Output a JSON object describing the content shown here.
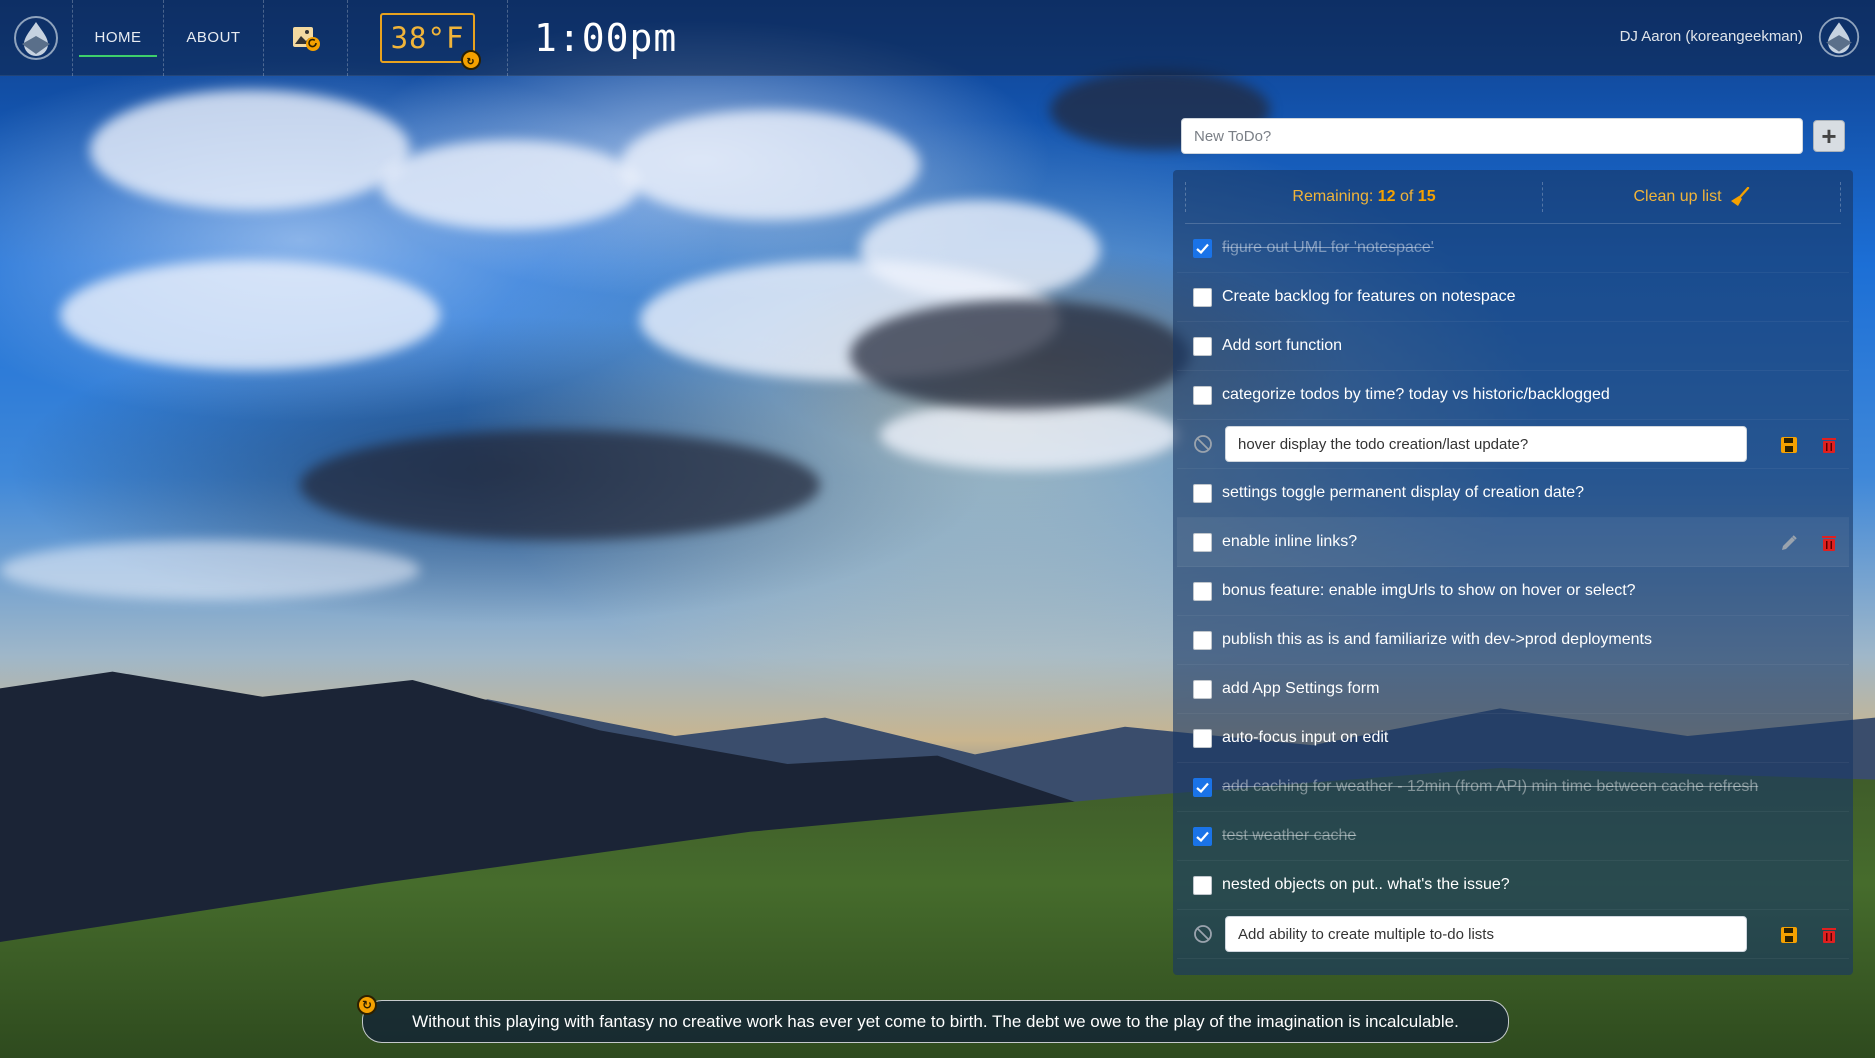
{
  "nav": {
    "home_label": "HOME",
    "about_label": "ABOUT",
    "weather_temp": "38°F",
    "clock": "1:00pm",
    "user_name": "DJ Aaron (koreangeekman)"
  },
  "todo": {
    "new_placeholder": "New ToDo?",
    "remaining_prefix": "Remaining: ",
    "remaining_count": "12",
    "remaining_of": " of ",
    "remaining_total": "15",
    "cleanup_label": "Clean up list",
    "items": [
      {
        "text": "figure out UML for 'notespace'",
        "done": true
      },
      {
        "text": "Create backlog for features on notespace",
        "done": false
      },
      {
        "text": "Add sort function",
        "done": false
      },
      {
        "text": "categorize todos by time? today vs historic/backlogged",
        "done": false
      },
      {
        "text": "hover display the todo creation/last update?",
        "editing": true
      },
      {
        "text": "settings toggle permanent display of creation date?",
        "done": false
      },
      {
        "text": "enable inline links?",
        "done": false,
        "hover": true
      },
      {
        "text": "bonus feature: enable imgUrls to show on hover or select?",
        "done": false
      },
      {
        "text": "publish this as is and familiarize with dev->prod deployments",
        "done": false
      },
      {
        "text": "add App Settings form",
        "done": false
      },
      {
        "text": "auto-focus input on edit",
        "done": false
      },
      {
        "text": "add caching for weather - 12min (from API) min time between cache refresh",
        "done": true
      },
      {
        "text": "test weather cache",
        "done": true
      },
      {
        "text": "nested objects on put.. what's the issue?",
        "done": false
      },
      {
        "text": "Add ability to create multiple to-do lists",
        "editing": true
      }
    ]
  },
  "quote": {
    "text": "Without this playing with fantasy no creative work has ever yet come to birth. The debt we owe to the play of the imagination is incalculable."
  },
  "colors": {
    "accent": "#f5a100",
    "active_nav": "#3ecf6b",
    "delete": "#e02020",
    "check": "#1a73e8"
  },
  "icons": {
    "brand": "drop-logo-icon",
    "bg_image": "image-refresh-icon",
    "refresh": "refresh-icon",
    "add": "plus-icon",
    "cleanup": "broom-icon",
    "cancel": "cancel-icon",
    "save": "save-icon",
    "delete": "trash-icon",
    "edit": "pencil-icon"
  }
}
